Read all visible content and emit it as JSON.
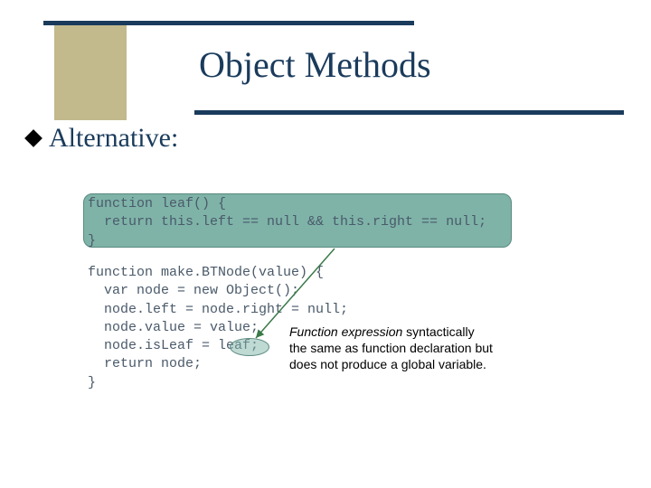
{
  "title": "Object Methods",
  "bullet": "Alternative:",
  "code_top": "function leaf() {\n  return this.left == null && this.right == null;\n}",
  "code_bottom": "function make.BTNode(value) {\n  var node = new Object();\n  node.left = node.right = null;\n  node.value = value;\n  node.isLeaf = leaf;\n  return node;\n}",
  "annotation_em": "Function expression",
  "annotation_rest": " syntactically\nthe same as function declaration but\ndoes not produce a global variable.",
  "colors": {
    "accent": "#1a3b5c",
    "khaki": "#c2b98c",
    "teal": "#7fb3a8"
  }
}
